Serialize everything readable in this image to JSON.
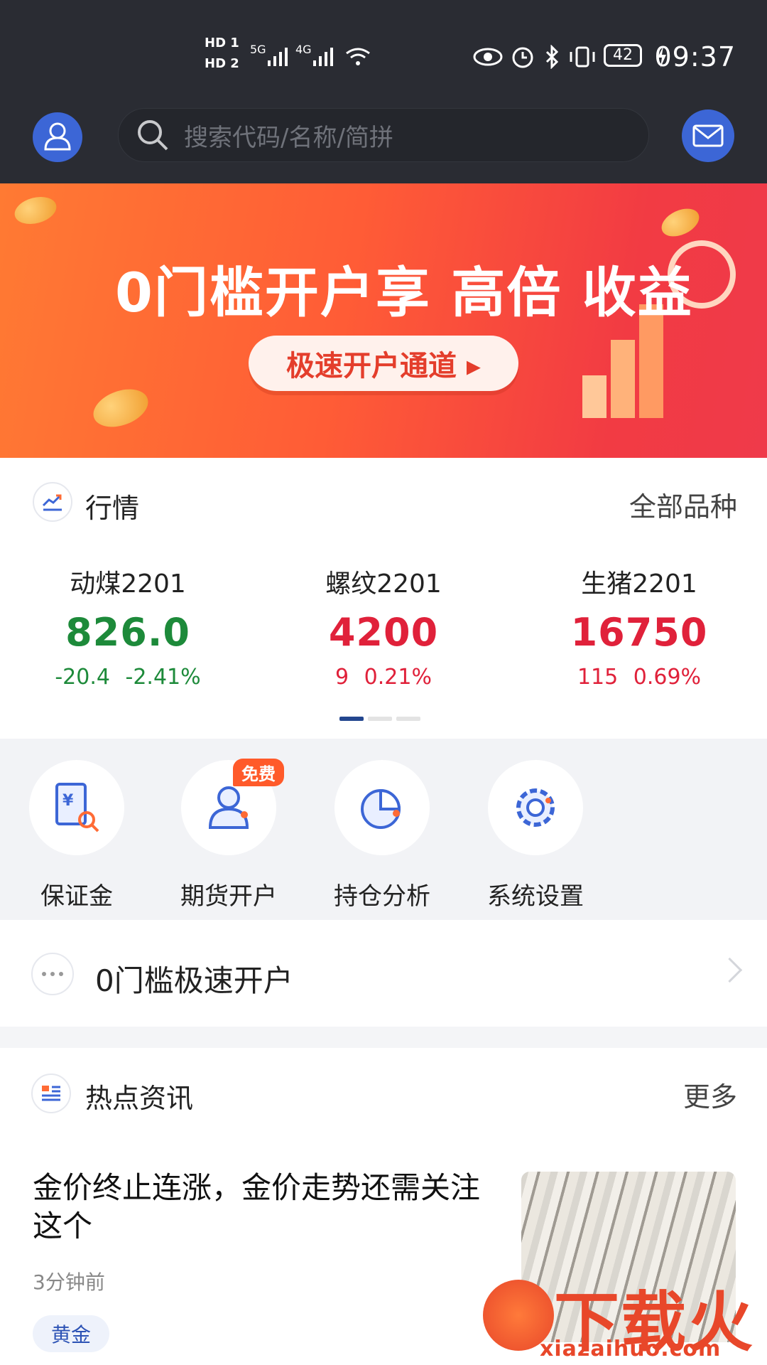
{
  "status_bar": {
    "sim1": "HD 1",
    "sim2": "HD 2",
    "net1": "5G",
    "net2": "4G",
    "battery": "42",
    "time": "09:37"
  },
  "header": {
    "search_placeholder": "搜索代码/名称/简拼"
  },
  "banner": {
    "title": "0门槛开户享 高倍 收益",
    "button": "极速开户通道 ▸"
  },
  "market": {
    "title": "行情",
    "link": "全部品种",
    "quotes": [
      {
        "name": "动煤2201",
        "price": "826.0",
        "change": "-20.4",
        "pct": "-2.41%",
        "trend": "down"
      },
      {
        "name": "螺纹2201",
        "price": "4200",
        "change": "9",
        "pct": "0.21%",
        "trend": "up"
      },
      {
        "name": "生猪2201",
        "price": "16750",
        "change": "115",
        "pct": "0.69%",
        "trend": "up"
      }
    ]
  },
  "shortcuts": [
    {
      "label": "保证金",
      "icon": "deposit-search-icon"
    },
    {
      "label": "期货开户",
      "icon": "user-account-icon",
      "badge": "免费"
    },
    {
      "label": "持仓分析",
      "icon": "pie-chart-icon"
    },
    {
      "label": "系统设置",
      "icon": "gear-icon"
    }
  ],
  "quick_open": {
    "label": "0门槛极速开户"
  },
  "news": {
    "title": "热点资讯",
    "link": "更多",
    "item": {
      "headline": "金价终止连涨，金价走势还需关注这个",
      "time": "3分钟前",
      "tag": "黄金"
    }
  },
  "watermark": {
    "text": "下载火",
    "url": "xiazaihuo.com"
  },
  "colors": {
    "accent_blue": "#3c66d6",
    "up_red": "#e0213a",
    "down_green": "#1d8a3a",
    "banner_orange": "#ff5c36"
  }
}
